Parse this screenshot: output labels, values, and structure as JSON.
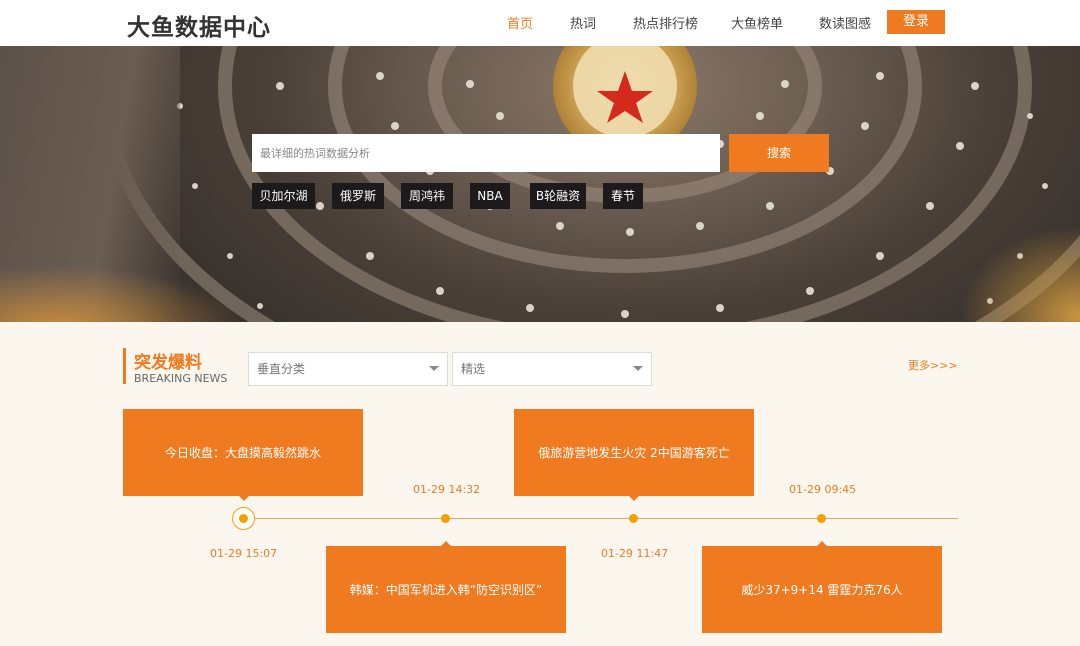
{
  "header": {
    "logo": "大鱼数据中心",
    "nav": [
      {
        "label": "首页",
        "active": true
      },
      {
        "label": "热词",
        "active": false
      },
      {
        "label": "热点排行榜",
        "active": false
      },
      {
        "label": "大鱼榜单",
        "active": false
      },
      {
        "label": "数读图感",
        "active": false
      }
    ],
    "login_label": "登录"
  },
  "hero": {
    "search_placeholder": "最详细的热词数据分析",
    "search_button": "搜索",
    "tags": [
      "贝加尔湖",
      "俄罗斯",
      "周鸿祎",
      "NBA",
      "B轮融资",
      "春节"
    ]
  },
  "breaking": {
    "title": "突发爆料",
    "subtitle": "BREAKING NEWS",
    "filter_category": "垂直分类",
    "filter_pick": "精选",
    "more": "更多>>>",
    "items": [
      {
        "headline": "今日收盘：大盘摸高毅然跳水",
        "time": "01-29 15:07"
      },
      {
        "headline": "韩媒：中国军机进入韩“防空识别区”",
        "time": "01-29 14:32"
      },
      {
        "headline": "俄旅游营地发生火灾 2中国游客死亡",
        "time": "01-29 11:47"
      },
      {
        "headline": "威少37+9+14 雷霆力克76人",
        "time": "01-29 09:45"
      }
    ]
  },
  "colors": {
    "accent": "#f07a20",
    "timeline_dot": "#f5a000",
    "section_bg": "#fbf7ef",
    "tag_bg": "#1c1a1a"
  }
}
